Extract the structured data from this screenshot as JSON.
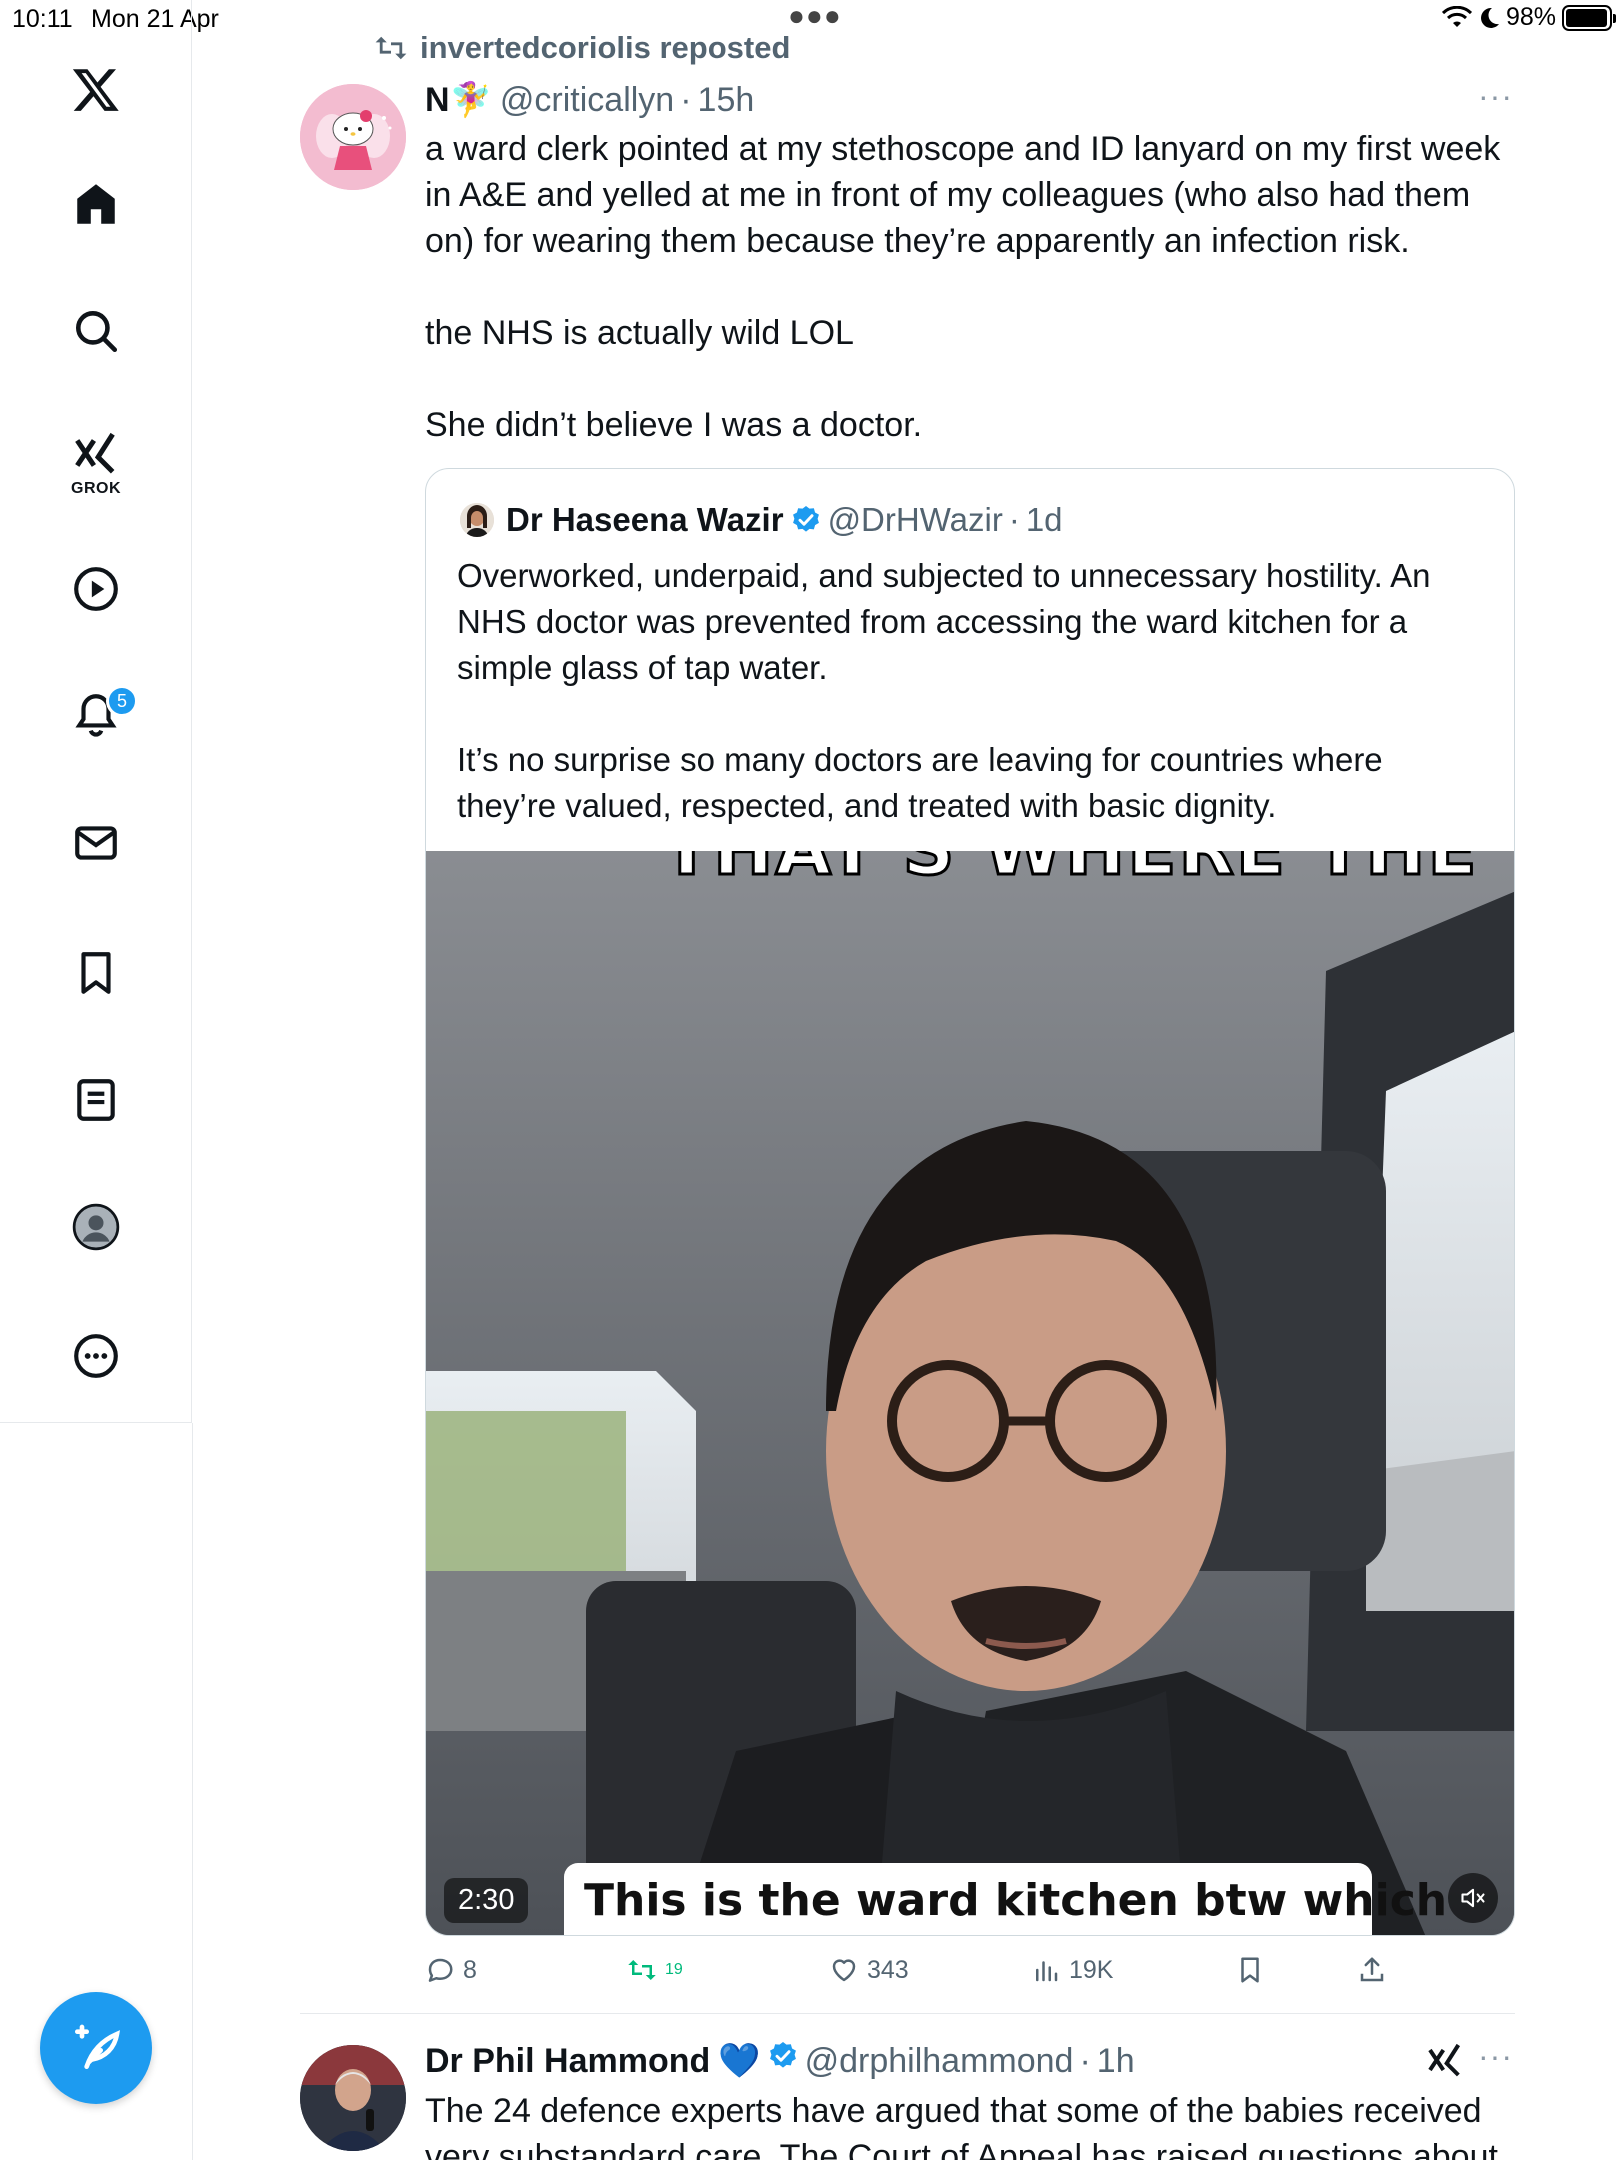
{
  "status_bar": {
    "time": "10:11",
    "date": "Mon 21 Apr",
    "battery": "98%",
    "battery_level": 0.98
  },
  "sidebar": {
    "grok_label": "GROK",
    "notifications_badge": "5",
    "items": [
      "x-logo",
      "home-icon",
      "search-icon",
      "grok-icon",
      "video-icon",
      "notifications-icon",
      "messages-icon",
      "bookmarks-icon",
      "lists-icon",
      "profile-icon",
      "more-icon"
    ]
  },
  "tweet": {
    "repost_label": "invertedcoriolis reposted",
    "name": "N🧚‍♀️",
    "handle": "@criticallyn",
    "dot": "·",
    "time": "15h",
    "text": [
      "a ward clerk pointed at my stethoscope and ID lanyard on my first week",
      "in A&E and yelled at me in front of my colleagues (who also had them",
      "on) for wearing them because they’re apparently an infection risk.",
      "the NHS is actually wild LOL",
      "She didn’t believe I was a doctor."
    ],
    "quoted": {
      "name": "Dr Haseena Wazir",
      "handle": "@DrHWazir",
      "time": "1d",
      "text": [
        "Overworked, underpaid, and subjected to unnecessary hostility. An",
        "NHS doctor was prevented from accessing the ward kitchen for a",
        "simple glass of tap water.",
        "It’s no surprise so many doctors are leaving for countries where",
        "they’re valued, respected, and treated with basic dignity."
      ],
      "video": {
        "caption_top": "THAT'S WHERE THE",
        "caption_bottom": "This is the ward kitchen btw which",
        "duration": "2:30"
      }
    },
    "actions": {
      "replies": "8",
      "reposts": "19",
      "likes": "343",
      "views": "19K"
    }
  },
  "next_tweet": {
    "name": "Dr Phil Hammond",
    "heart": "💙",
    "handle": "@drphilhammond",
    "time": "1h",
    "text": "The 24 defence experts have argued that some of the babies received",
    "text2": "very substandard care. The Court of Appeal has raised questions about"
  },
  "colors": {
    "accent": "#1d9bf0",
    "repost_green": "#00ba7c",
    "secondary_text": "#536471"
  }
}
